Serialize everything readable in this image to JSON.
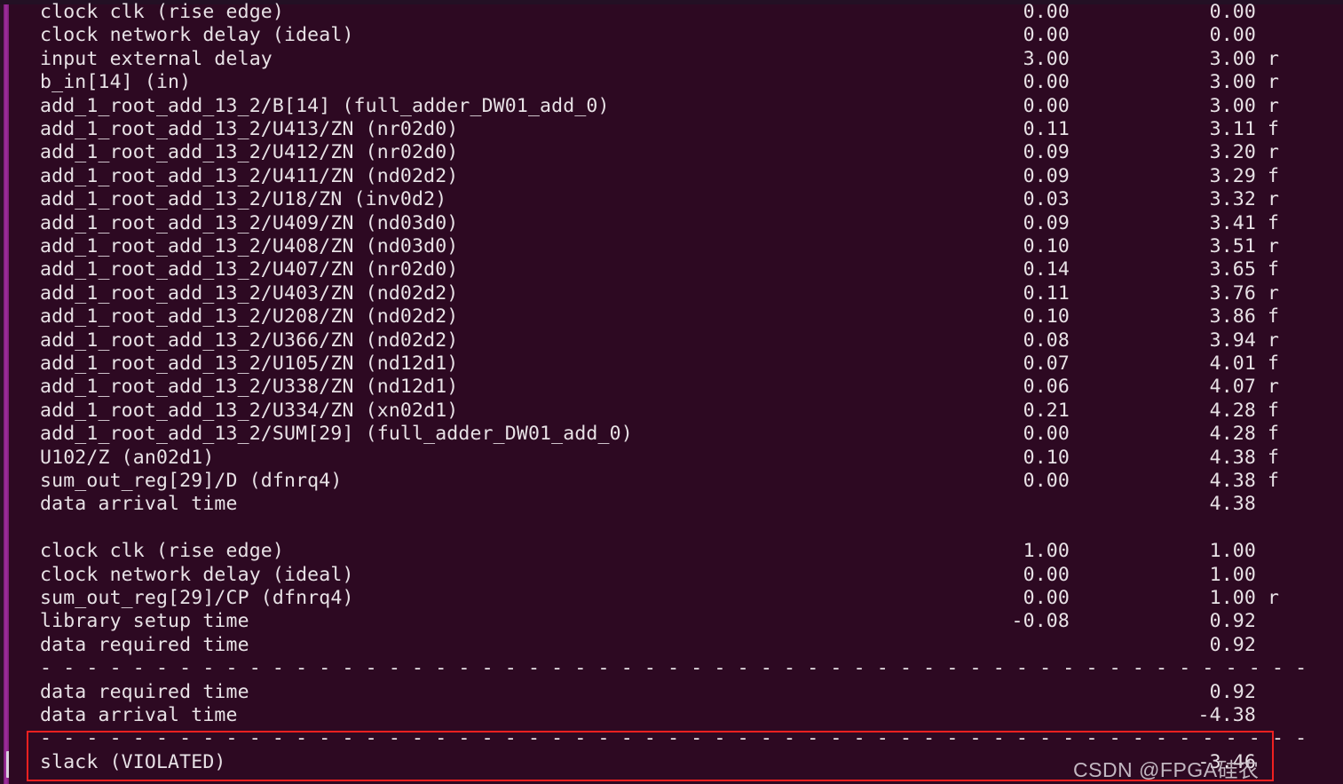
{
  "terminal": {
    "window_kind": "ubuntu-terminal",
    "colors": {
      "background": "#2d0922",
      "foreground": "#e8e2e6",
      "scrollbar": "#a02ea0",
      "highlight_box": "#f02020"
    },
    "separator_text": "- - - - - - - - - - - - - - - - - - - - - - - - - - - - - - - - - - - - - - - - - - - - - - - - - - - - - - -",
    "report_lines": [
      {
        "text": "clock clk (rise edge)",
        "incr": "0.00",
        "path": "0.00",
        "edge": ""
      },
      {
        "text": "clock network delay (ideal)",
        "incr": "0.00",
        "path": "0.00",
        "edge": ""
      },
      {
        "text": "input external delay",
        "incr": "3.00",
        "path": "3.00",
        "edge": "r"
      },
      {
        "text": "b_in[14] (in)",
        "incr": "0.00",
        "path": "3.00",
        "edge": "r"
      },
      {
        "text": "add_1_root_add_13_2/B[14] (full_adder_DW01_add_0)",
        "incr": "0.00",
        "path": "3.00",
        "edge": "r"
      },
      {
        "text": "add_1_root_add_13_2/U413/ZN (nr02d0)",
        "incr": "0.11",
        "path": "3.11",
        "edge": "f"
      },
      {
        "text": "add_1_root_add_13_2/U412/ZN (nr02d0)",
        "incr": "0.09",
        "path": "3.20",
        "edge": "r"
      },
      {
        "text": "add_1_root_add_13_2/U411/ZN (nd02d2)",
        "incr": "0.09",
        "path": "3.29",
        "edge": "f"
      },
      {
        "text": "add_1_root_add_13_2/U18/ZN (inv0d2)",
        "incr": "0.03",
        "path": "3.32",
        "edge": "r"
      },
      {
        "text": "add_1_root_add_13_2/U409/ZN (nd03d0)",
        "incr": "0.09",
        "path": "3.41",
        "edge": "f"
      },
      {
        "text": "add_1_root_add_13_2/U408/ZN (nd03d0)",
        "incr": "0.10",
        "path": "3.51",
        "edge": "r"
      },
      {
        "text": "add_1_root_add_13_2/U407/ZN (nr02d0)",
        "incr": "0.14",
        "path": "3.65",
        "edge": "f"
      },
      {
        "text": "add_1_root_add_13_2/U403/ZN (nd02d2)",
        "incr": "0.11",
        "path": "3.76",
        "edge": "r"
      },
      {
        "text": "add_1_root_add_13_2/U208/ZN (nd02d2)",
        "incr": "0.10",
        "path": "3.86",
        "edge": "f"
      },
      {
        "text": "add_1_root_add_13_2/U366/ZN (nd02d2)",
        "incr": "0.08",
        "path": "3.94",
        "edge": "r"
      },
      {
        "text": "add_1_root_add_13_2/U105/ZN (nd12d1)",
        "incr": "0.07",
        "path": "4.01",
        "edge": "f"
      },
      {
        "text": "add_1_root_add_13_2/U338/ZN (nd12d1)",
        "incr": "0.06",
        "path": "4.07",
        "edge": "r"
      },
      {
        "text": "add_1_root_add_13_2/U334/ZN (xn02d1)",
        "incr": "0.21",
        "path": "4.28",
        "edge": "f"
      },
      {
        "text": "add_1_root_add_13_2/SUM[29] (full_adder_DW01_add_0)",
        "incr": "0.00",
        "path": "4.28",
        "edge": "f"
      },
      {
        "text": "U102/Z (an02d1)",
        "incr": "0.10",
        "path": "4.38",
        "edge": "f"
      },
      {
        "text": "sum_out_reg[29]/D (dfnrq4)",
        "incr": "0.00",
        "path": "4.38",
        "edge": "f"
      },
      {
        "text": "data arrival time",
        "incr": "",
        "path": "4.38",
        "edge": ""
      },
      {
        "text": "",
        "incr": "",
        "path": "",
        "edge": ""
      },
      {
        "text": "clock clk (rise edge)",
        "incr": "1.00",
        "path": "1.00",
        "edge": ""
      },
      {
        "text": "clock network delay (ideal)",
        "incr": "0.00",
        "path": "1.00",
        "edge": ""
      },
      {
        "text": "sum_out_reg[29]/CP (dfnrq4)",
        "incr": "0.00",
        "path": "1.00",
        "edge": "r"
      },
      {
        "text": "library setup time",
        "incr": "-0.08",
        "path": "0.92",
        "edge": ""
      },
      {
        "text": "data required time",
        "incr": "",
        "path": "0.92",
        "edge": ""
      },
      {
        "text": "__SEPARATOR__",
        "incr": "",
        "path": "",
        "edge": ""
      },
      {
        "text": "data required time",
        "incr": "",
        "path": "0.92",
        "edge": ""
      },
      {
        "text": "data arrival time",
        "incr": "",
        "path": "-4.38",
        "edge": ""
      },
      {
        "text": "__SEPARATOR__",
        "incr": "",
        "path": "",
        "edge": ""
      },
      {
        "text": "slack (VIOLATED)",
        "incr": "",
        "path": "-3.46",
        "edge": ""
      }
    ]
  },
  "watermark": {
    "text": "CSDN @FPGA硅农"
  }
}
